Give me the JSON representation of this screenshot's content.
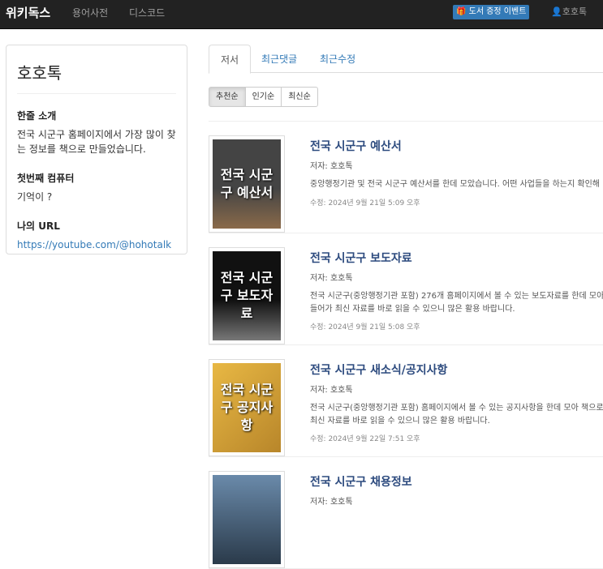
{
  "nav": {
    "brand": "위키독스",
    "links": [
      "용어사전",
      "디스코드"
    ],
    "event": "도서 증정 이벤트",
    "user": "호호톡"
  },
  "sidebar": {
    "name": "호호톡",
    "intro_title": "한줄 소개",
    "intro": "전국 시군구 홈페이지에서 가장 많이 찾는 정보를 책으로 만들었습니다.",
    "computer_title": "첫번째 컴퓨터",
    "computer": "기억이 ?",
    "url_title": "나의 URL",
    "url": "https://youtube.com/@hohotalk"
  },
  "tabs": [
    "저서",
    "최근댓글",
    "최근수정"
  ],
  "sort": [
    "추천순",
    "인기순",
    "최신순"
  ],
  "books": [
    {
      "title": "전국 시군구 예산서",
      "cover": "전국 시군구 예산서",
      "author": "저자: 호호톡",
      "desc": "중앙행정기관 및 전국 시군구 예산서를 한데 모았습니다. 어떤 사업들을 하는지 확인해",
      "date": "수정: 2024년 9월 21일 5:09 오후",
      "color": "#8a6a4a"
    },
    {
      "title": "전국 시군구 보도자료",
      "cover": "전국 시군구 보도자료",
      "author": "저자: 호호톡",
      "desc": "전국 시군구(중앙행정기관 포함) 276개 홈페이지에서 볼 수 있는 보도자료를 한데 모아\n들어가 최신 자료를 바로 읽을 수 있으니 많은 활용 바랍니다.",
      "date": "수정: 2024년 9월 21일 5:08 오후",
      "color": "#333333"
    },
    {
      "title": "전국 시군구 새소식/공지사항",
      "cover": "전국 시군구 공지사항",
      "author": "저자: 호호톡",
      "desc": "전국 시군구(중앙행정기관 포함) 홈페이지에서 볼 수 있는 공지사항을 한데 모아 책으로\n최신 자료를 바로 읽을 수 있으니 많은 활용 바랍니다.",
      "date": "수정: 2024년 9월 22일 7:51 오후",
      "color": "#d9a53a"
    },
    {
      "title": "전국 시군구 채용정보",
      "cover": "",
      "author": "저자: 호호톡",
      "desc": "",
      "date": "",
      "color": "#4a6a8a"
    }
  ]
}
